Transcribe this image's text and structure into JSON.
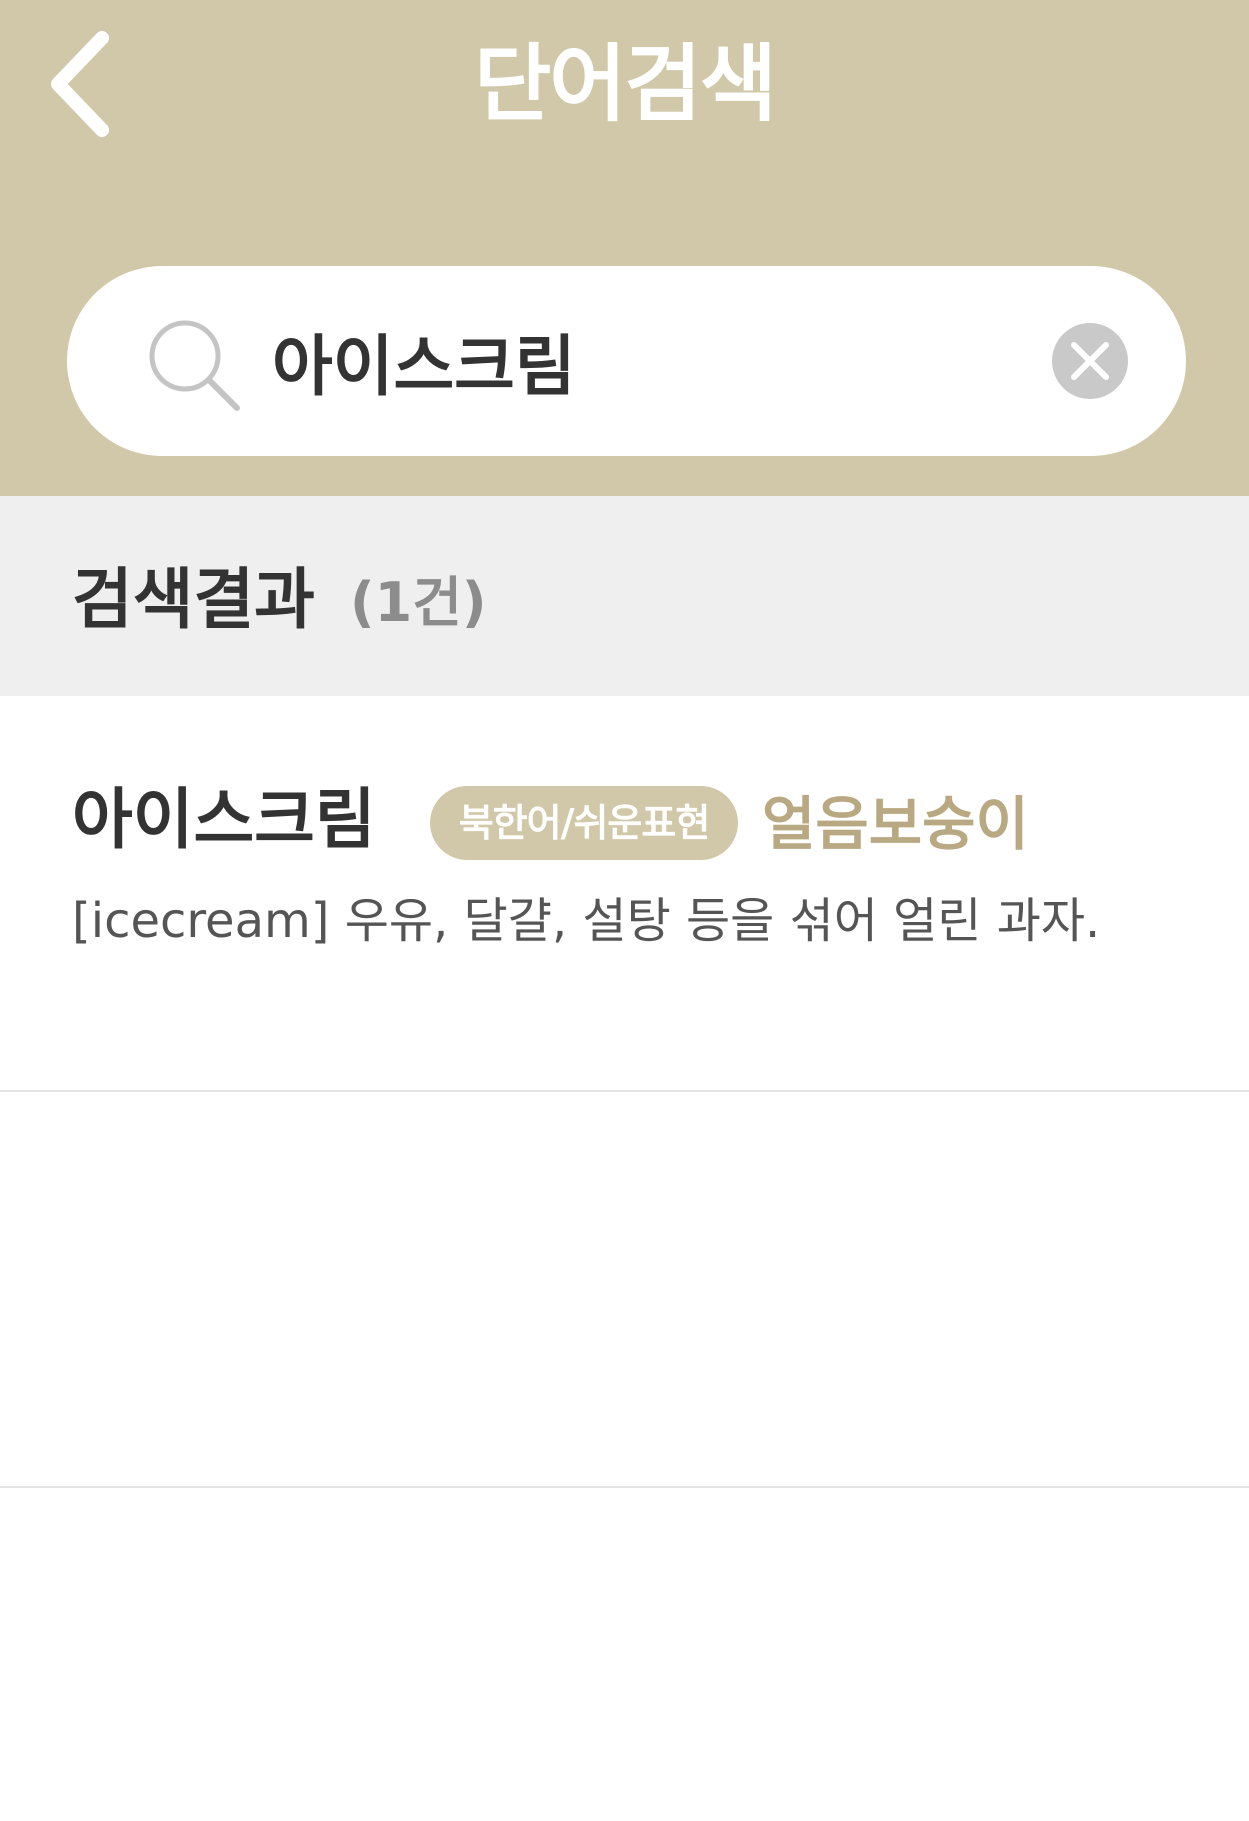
{
  "header": {
    "title": "단어검색",
    "background_color": "#d0c8a8"
  },
  "search": {
    "value": "아이스크림",
    "placeholder": ""
  },
  "results": {
    "title": "검색결과",
    "count": "(1건)"
  },
  "items": [
    {
      "word": "아이스크림",
      "badge": "북한어/쉬운표현",
      "alt_word": "얼음보숭이",
      "definition": "[icecream] 우유, 달걀, 설탕 등을 섞어 얼린 과자."
    }
  ],
  "colors": {
    "accent": "#d0c8a8",
    "alt_word": "#b9a982",
    "section_bg": "#efefef"
  },
  "icons": {
    "back": "chevron-left-icon",
    "search": "search-icon",
    "clear": "clear-circle-icon"
  }
}
